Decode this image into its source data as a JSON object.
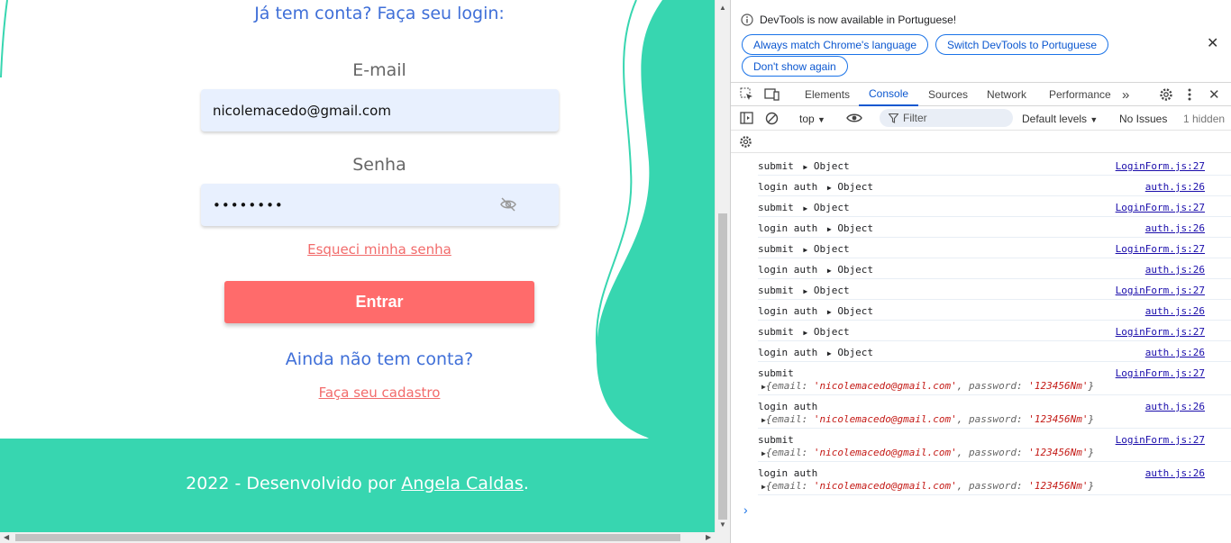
{
  "page": {
    "login_title": "Já tem conta? Faça seu login:",
    "email_label": "E-mail",
    "email_value": "nicolemacedo@gmail.com",
    "password_label": "Senha",
    "password_value": "••••••••",
    "forgot_link": "Esqueci minha senha",
    "login_button": "Entrar",
    "signup_question": "Ainda não tem conta?",
    "signup_link": "Faça seu cadastro",
    "footer_prefix": "2022 - Desenvolvido por ",
    "footer_author": "Angela Caldas",
    "footer_suffix": ".",
    "colors": {
      "accent": "#37d6b0",
      "button": "#ff6b6b",
      "link": "#f26b6b",
      "title": "#3f6fd8"
    }
  },
  "devtools": {
    "info_message": "DevTools is now available in Portuguese!",
    "info_buttons": [
      "Always match Chrome's language",
      "Switch DevTools to Portuguese",
      "Don't show again"
    ],
    "tabs": [
      "Elements",
      "Console",
      "Sources",
      "Network",
      "Performance"
    ],
    "active_tab": "Console",
    "toolbar": {
      "context": "top",
      "filter_placeholder": "Filter",
      "levels": "Default levels",
      "issues": "No Issues",
      "hidden": "1 hidden"
    },
    "logs": [
      {
        "msg": "submit",
        "src": "LoginForm.js:27"
      },
      {
        "msg": "login auth",
        "src": "auth.js:26"
      },
      {
        "msg": "submit",
        "src": "LoginForm.js:27"
      },
      {
        "msg": "login auth",
        "src": "auth.js:26"
      },
      {
        "msg": "submit",
        "src": "LoginForm.js:27"
      },
      {
        "msg": "login auth",
        "src": "auth.js:26"
      },
      {
        "msg": "submit",
        "src": "LoginForm.js:27"
      },
      {
        "msg": "login auth",
        "src": "auth.js:26"
      },
      {
        "msg": "submit",
        "src": "LoginForm.js:27"
      },
      {
        "msg": "login auth",
        "src": "auth.js:26"
      }
    ],
    "object_label": "Object",
    "expanded_logs": [
      {
        "msg": "submit",
        "src": "LoginForm.js:27",
        "email": "'nicolemacedo@gmail.com'",
        "password": "'123456Nm'"
      },
      {
        "msg": "login auth",
        "src": "auth.js:26",
        "email": "'nicolemacedo@gmail.com'",
        "password": "'123456Nm'"
      },
      {
        "msg": "submit",
        "src": "LoginForm.js:27",
        "email": "'nicolemacedo@gmail.com'",
        "password": "'123456Nm'"
      },
      {
        "msg": "login auth",
        "src": "auth.js:26",
        "email": "'nicolemacedo@gmail.com'",
        "password": "'123456Nm'"
      }
    ],
    "key_email": "email",
    "key_password": "password",
    "prompt": "›"
  }
}
